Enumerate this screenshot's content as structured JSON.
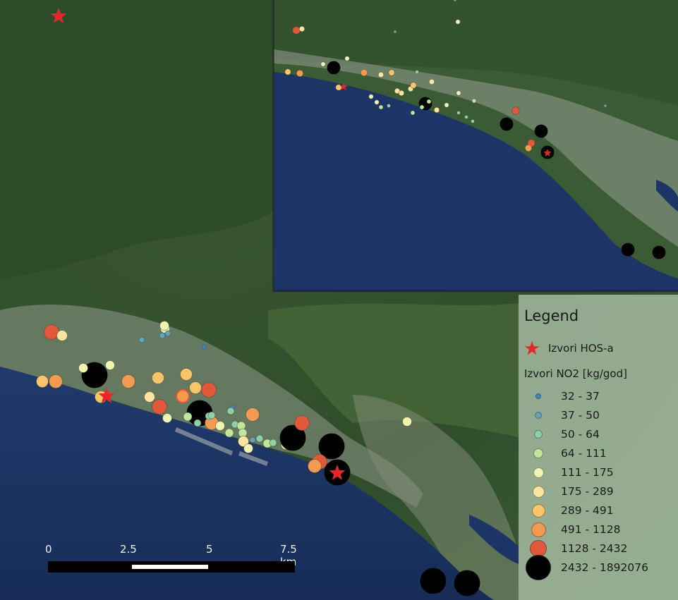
{
  "legend": {
    "title": "Legend",
    "hos_label": "Izvori HOS-a",
    "no2_title": "Izvori NO2 [kg/god]",
    "classes": [
      {
        "label": "32 - 37",
        "color": "#3f86c0"
      },
      {
        "label": "37 - 50",
        "color": "#5fa6b8"
      },
      {
        "label": "50 - 64",
        "color": "#8fd0a8"
      },
      {
        "label": "64 - 111",
        "color": "#bfe69a"
      },
      {
        "label": "111 - 175",
        "color": "#eff5b0"
      },
      {
        "label": "175 - 289",
        "color": "#fde4a0"
      },
      {
        "label": "289 - 491",
        "color": "#f8c56a"
      },
      {
        "label": "491 - 1128",
        "color": "#f19a50"
      },
      {
        "label": "1128 - 2432",
        "color": "#e1583a"
      },
      {
        "label": "2432 - 1892076",
        "color": "#000000"
      }
    ]
  },
  "scale": {
    "ticks": [
      "0",
      "2.5",
      "5",
      "7.5 km"
    ]
  },
  "colors": {
    "sea": "#1d3566",
    "land": "#3e5e34",
    "urban": "#8f9a8c",
    "hos_star": "#e8262a"
  }
}
